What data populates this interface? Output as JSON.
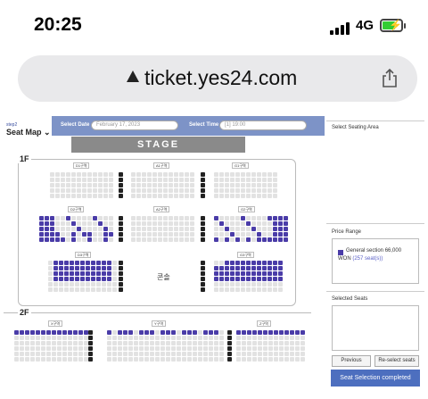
{
  "status": {
    "time": "20:25",
    "network": "4G"
  },
  "browser": {
    "url": "ticket.yes24.com"
  },
  "page": {
    "step_id": "step2",
    "seatmap_title": "Seat Map",
    "select_date_label": "Select Date",
    "select_date_value": "February 17, 2023",
    "select_time_label": "Select Time",
    "select_time_value": "[1] 19:00",
    "stage_label": "STAGE",
    "floor1_label": "1F",
    "floor2_label": "2F",
    "console_label": "콘솔"
  },
  "sidebar": {
    "select_area": "Select Seating Area",
    "price_range": "Price Range",
    "price_item": "General section 66,000",
    "price_currency": "WON",
    "price_seats": "(257 seat(s))",
    "selected_seats": "Selected Seats",
    "previous": "Previous",
    "reselect": "Re-select seats",
    "complete": "Seat Selection completed"
  },
  "sections": {
    "d1": "D1구역",
    "a1": "A1구역",
    "g1": "G1구역",
    "d2": "D2구역",
    "a2": "A2구역",
    "g2": "G2구역",
    "d3": "D3구역",
    "g3": "G3구역",
    "x": "X구역",
    "y": "Y구역",
    "z": "Z구역"
  },
  "colors": {
    "available": "#4a3ca8",
    "taken": "#e2e2e2",
    "accent": "#4d6fbf"
  }
}
